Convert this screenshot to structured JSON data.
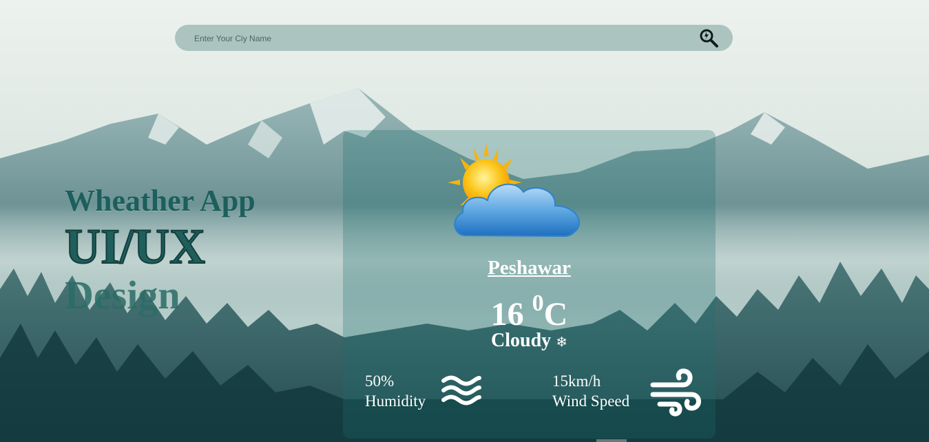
{
  "search": {
    "placeholder": "Enter Your Ciy Name",
    "button_icon": "search-icon"
  },
  "hero": {
    "line1": "Wheather App",
    "line2": "UI/UX",
    "line3": "Design"
  },
  "weather": {
    "city": "Peshawar",
    "temp_value": "16",
    "temp_degree": "0",
    "temp_unit": "C",
    "condition": "Cloudy",
    "condition_icon": "snowflake-icon",
    "condition_glyph": "❄",
    "icon": "partly-cloudy-icon"
  },
  "humidity": {
    "value": "50%",
    "label": "Humidity",
    "icon": "waves-icon"
  },
  "wind": {
    "value": "15km/h",
    "label": "Wind Speed",
    "icon": "wind-icon"
  },
  "colors": {
    "title": "#1c5f5d",
    "card": "#1e6e6e",
    "search_bar": "#78a09b"
  }
}
